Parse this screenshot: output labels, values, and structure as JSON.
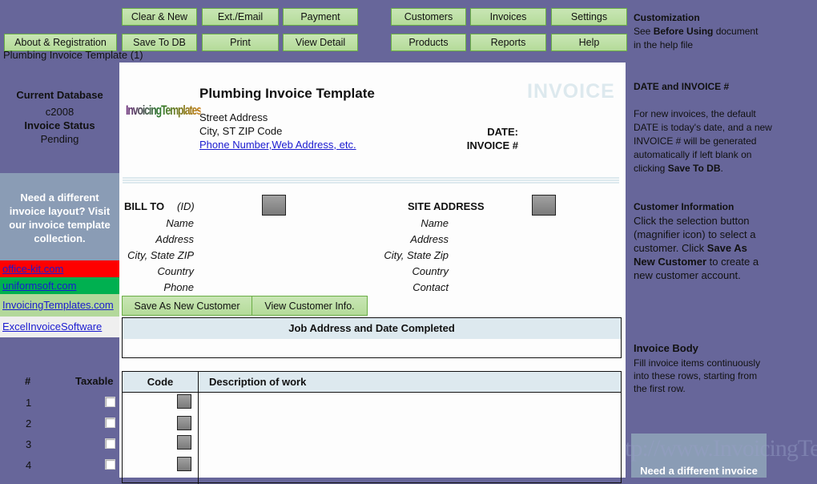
{
  "toolbar": {
    "row1": [
      "Clear & New",
      "Ext./Email",
      "Payment",
      "Customers",
      "Invoices",
      "Settings"
    ],
    "row2": [
      "About & Registration",
      "Save To DB",
      "Print",
      "View Detail",
      "Products",
      "Reports",
      "Help"
    ]
  },
  "document_title": "Plumbing Invoice Template (1)",
  "sidebar": {
    "db_label": "Current Database",
    "db_value": "c2008",
    "status_label": "Invoice Status",
    "status_value": "Pending",
    "promo_text": "Need a different invoice layout? Visit our invoice template collection.",
    "links": [
      {
        "label": "office-kit.com ",
        "bg": "#fe0000"
      },
      {
        "label": "uniformsoft.com ",
        "bg": "#00b050"
      },
      {
        "label": "InvoicingTemplates.com ",
        "bg": "#b3d89b"
      },
      {
        "label": "ExcelInvoiceSoftware",
        "bg": "#efefef"
      }
    ],
    "items_header": {
      "num": "#",
      "taxable": "Taxable"
    },
    "rows": [
      "1",
      "2",
      "3",
      "4"
    ]
  },
  "invoice": {
    "logo_text": "InvoicingTemplates",
    "company_name": "Plumbing Invoice Template",
    "street": "Street Address",
    "city": "City, ST  ZIP Code",
    "contact_link": "Phone Number,Web Address, etc.",
    "watermark_title": "INVOICE",
    "date_label": "DATE:",
    "invoice_no_label": "INVOICE #",
    "bill_to": {
      "title": "BILL TO",
      "id_label": "(ID)",
      "fields": [
        "Name",
        "Address",
        "City, State ZIP",
        "Country",
        "Phone"
      ]
    },
    "site_address": {
      "title": "SITE ADDRESS",
      "fields": [
        "Name",
        "Address",
        "City, State Zip",
        "Country",
        "Contact"
      ]
    },
    "save_customer_label": "Save As New Customer",
    "view_customer_label": "View Customer Info.",
    "job_header": "Job Address and Date Completed",
    "items_columns": {
      "code": "Code",
      "description": "Description of work"
    }
  },
  "help": {
    "customization": {
      "title": "Customization",
      "line1_pre": "See ",
      "line1_bold": "Before Using",
      "line1_post": " document",
      "line2": "in the help file"
    },
    "date_invoice": {
      "title": "DATE and INVOICE #",
      "body_pre": "For new invoices, the default DATE is today's date, and a new INVOICE # will be generated automatically if left blank  on clicking ",
      "body_bold": "Save To DB",
      "body_post": "."
    },
    "customer_info": {
      "title": "Customer Information",
      "body_pre": "Click the selection button (magnifier icon) to select a customer. Click ",
      "body_bold": "Save As New Customer",
      "body_post": " to create a new customer account."
    },
    "invoice_body": {
      "title": "Invoice Body",
      "body": "Fill invoice items continuously into these rows, starting from the first row."
    },
    "promo_text": "Need a different invoice",
    "watermark": "tp://www.InvoicingTemplate.com"
  }
}
